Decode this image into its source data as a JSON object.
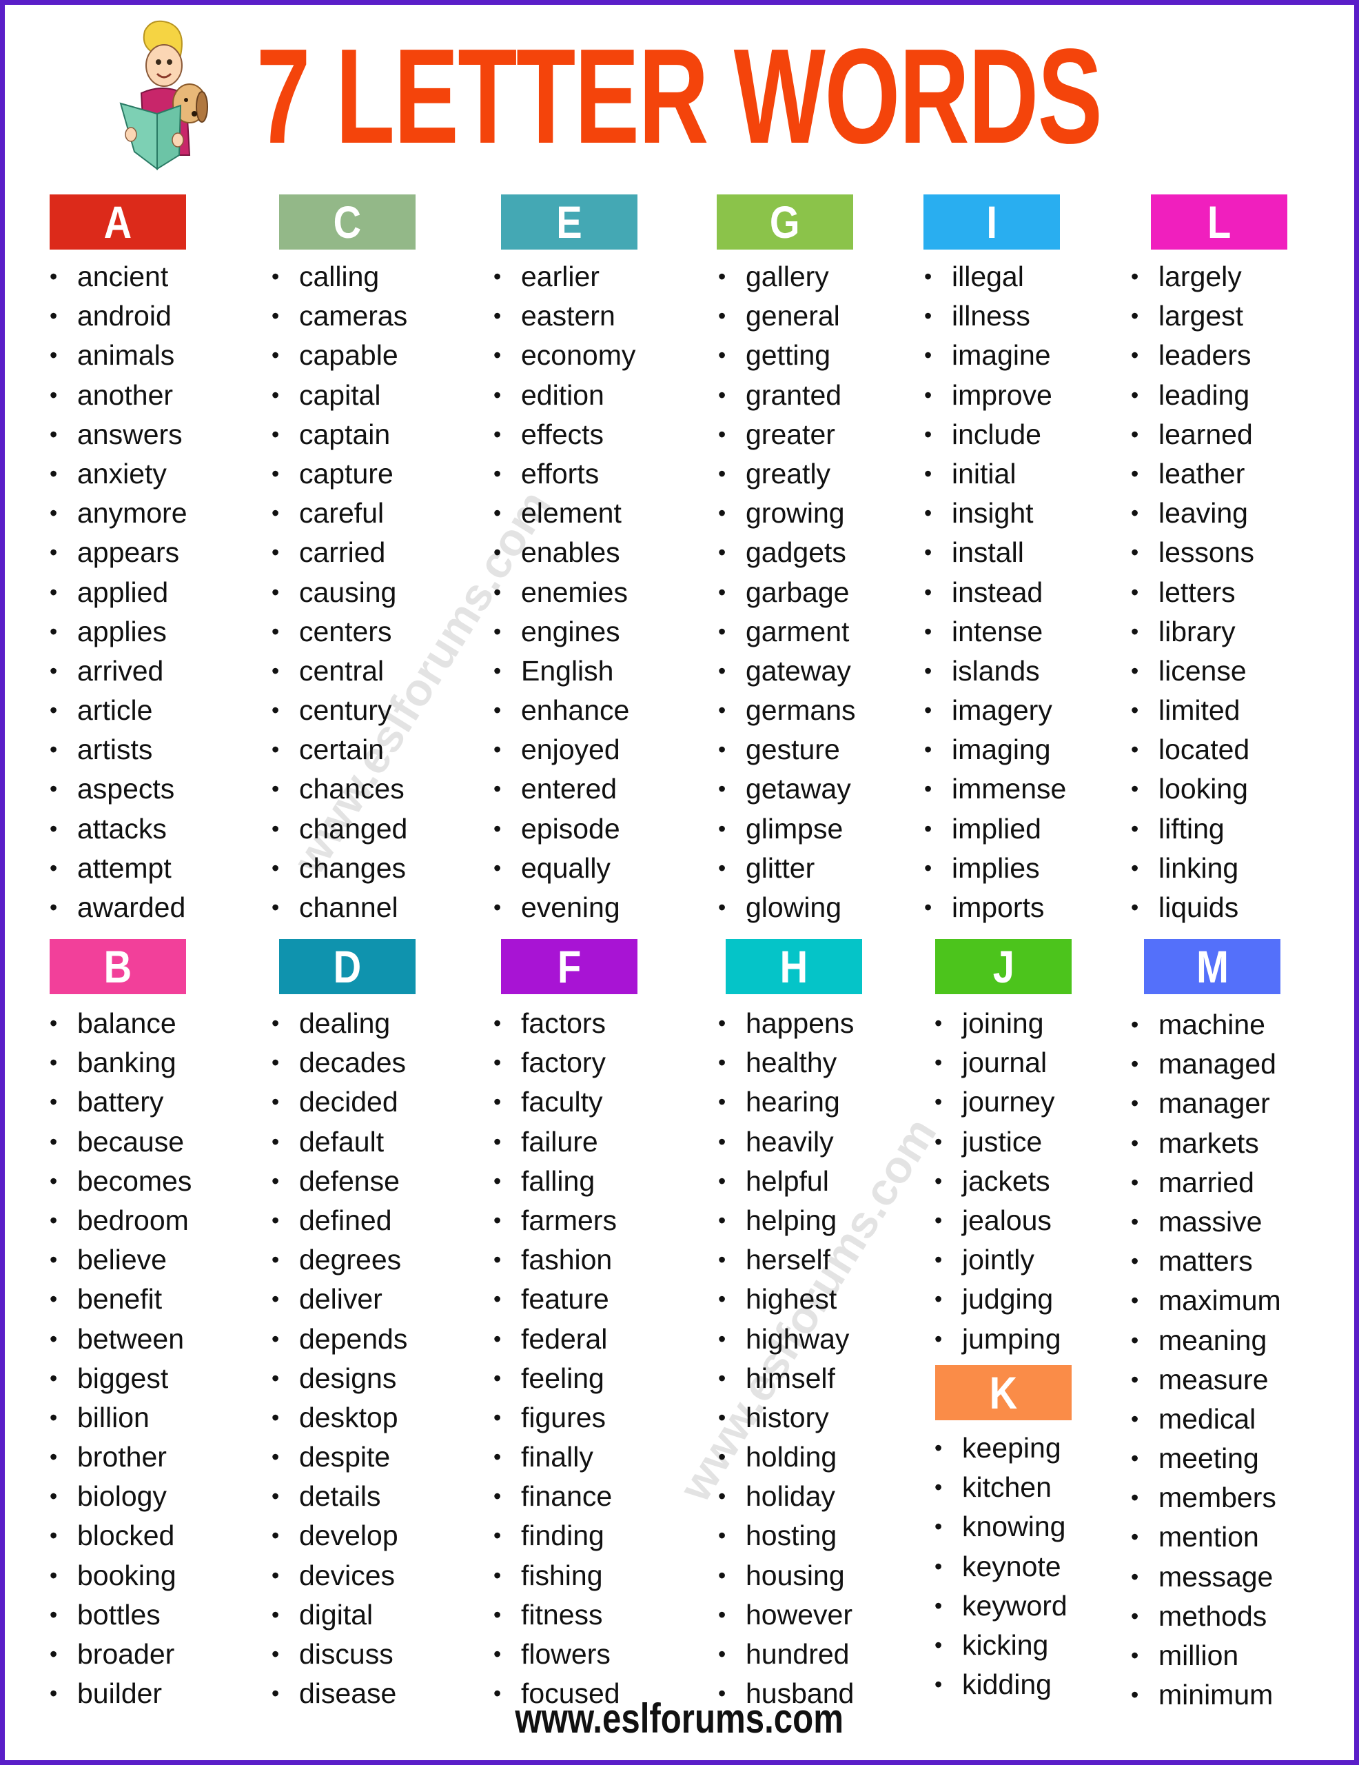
{
  "page": {
    "title": "7 LETTER WORDS",
    "footer_url": "www.eslforums.com",
    "watermark": "www.eslforums.com",
    "colors": {
      "border": "#5a1ec8",
      "title": "#f4440b"
    }
  },
  "mascot": {
    "icon": "child-reading-book-with-dog-icon"
  },
  "sections": {
    "A": {
      "letter": "A",
      "color": "#dc2a1a",
      "words": [
        "ancient",
        "android",
        "animals",
        "another",
        "answers",
        "anxiety",
        "anymore",
        "appears",
        "applied",
        "applies",
        "arrived",
        "article",
        "artists",
        "aspects",
        "attacks",
        "attempt",
        "awarded"
      ]
    },
    "C": {
      "letter": "C",
      "color": "#93b888",
      "words": [
        "calling",
        "cameras",
        "capable",
        "capital",
        "captain",
        "capture",
        "careful",
        "carried",
        "causing",
        "centers",
        "central",
        "century",
        "certain",
        "chances",
        "changed",
        "changes",
        "channel"
      ]
    },
    "E": {
      "letter": "E",
      "color": "#44a8b4",
      "words": [
        "earlier",
        "eastern",
        "economy",
        "edition",
        "effects",
        "efforts",
        "element",
        "enables",
        "enemies",
        "engines",
        "English",
        "enhance",
        "enjoyed",
        "entered",
        "episode",
        "equally",
        "evening"
      ]
    },
    "G": {
      "letter": "G",
      "color": "#8bc34a",
      "words": [
        "gallery",
        "general",
        "getting",
        "granted",
        "greater",
        "greatly",
        "growing",
        "gadgets",
        "garbage",
        "garment",
        "gateway",
        "germans",
        "gesture",
        "getaway",
        "glimpse",
        "glitter",
        "glowing"
      ]
    },
    "I": {
      "letter": "I",
      "color": "#29aef0",
      "words": [
        "illegal",
        "illness",
        "imagine",
        "improve",
        "include",
        "initial",
        "insight",
        "install",
        "instead",
        "intense",
        "islands",
        "imagery",
        "imaging",
        "immense",
        "implied",
        "implies",
        "imports"
      ]
    },
    "L": {
      "letter": "L",
      "color": "#f01fbe",
      "words": [
        "largely",
        "largest",
        "leaders",
        "leading",
        "learned",
        "leather",
        "leaving",
        "lessons",
        "letters",
        "library",
        "license",
        "limited",
        "located",
        "looking",
        "lifting",
        "linking",
        "liquids"
      ]
    },
    "B": {
      "letter": "B",
      "color": "#f2409a",
      "words": [
        "balance",
        "banking",
        "battery",
        "because",
        "becomes",
        "bedroom",
        "believe",
        "benefit",
        "between",
        "biggest",
        "billion",
        "brother",
        "biology",
        "blocked",
        "booking",
        "bottles",
        "broader",
        "builder"
      ]
    },
    "D": {
      "letter": "D",
      "color": "#0f93ae",
      "words": [
        "dealing",
        "decades",
        "decided",
        "default",
        "defense",
        "defined",
        "degrees",
        "deliver",
        "depends",
        "designs",
        "desktop",
        "despite",
        "details",
        "develop",
        "devices",
        "digital",
        "discuss",
        "disease"
      ]
    },
    "F": {
      "letter": "F",
      "color": "#a814d4",
      "words": [
        "factors",
        "factory",
        "faculty",
        "failure",
        "falling",
        "farmers",
        "fashion",
        "feature",
        "federal",
        "feeling",
        "figures",
        "finally",
        "finance",
        "finding",
        "fishing",
        "fitness",
        "flowers",
        "focused"
      ]
    },
    "H": {
      "letter": "H",
      "color": "#05c4c8",
      "words": [
        "happens",
        "healthy",
        "hearing",
        "heavily",
        "helpful",
        "helping",
        "herself",
        "highest",
        "highway",
        "himself",
        "history",
        "holding",
        "holiday",
        "hosting",
        "housing",
        "however",
        "hundred",
        "husband"
      ]
    },
    "J": {
      "letter": "J",
      "color": "#4cc41c",
      "words": [
        "joining",
        "journal",
        "journey",
        "justice",
        "jackets",
        "jealous",
        "jointly",
        "judging",
        "jumping"
      ]
    },
    "K": {
      "letter": "K",
      "color": "#fa8c48",
      "words": [
        "keeping",
        "kitchen",
        "knowing",
        "keynote",
        "keyword",
        "kicking",
        "kidding"
      ]
    },
    "M": {
      "letter": "M",
      "color": "#5470fa",
      "words": [
        "machine",
        "managed",
        "manager",
        "markets",
        "married",
        "massive",
        "matters",
        "maximum",
        "meaning",
        "measure",
        "medical",
        "meeting",
        "members",
        "mention",
        "message",
        "methods",
        "million",
        "minimum"
      ]
    }
  }
}
